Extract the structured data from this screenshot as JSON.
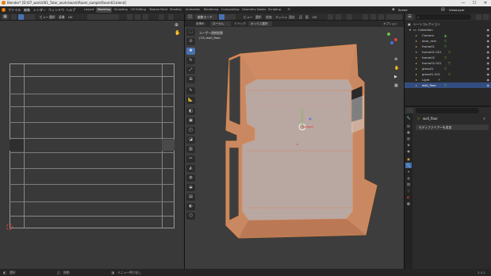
{
  "window": {
    "title": "Blender* [D:\\07_work\\001_Tutor_works\\work\\Room_sample\\Room03.blend]",
    "minimize": "—",
    "maximize": "☐",
    "close": "✕"
  },
  "menu": {
    "items": [
      "ファイル",
      "編集",
      "レンダー",
      "ウィンドウ",
      "ヘルプ"
    ],
    "workspaces": [
      "Layout",
      "Modeling",
      "Sculpting",
      "UV Editing",
      "Texture Paint",
      "Shading",
      "Animation",
      "Rendering",
      "Compositing",
      "Geometry Nodes",
      "Scripting"
    ],
    "active_workspace": "Modeling",
    "scene": "Scene",
    "view_layer": "ViewLayer"
  },
  "uv_editor": {
    "header_items": [
      "ビュー",
      "選択",
      "画像",
      "UV"
    ]
  },
  "viewport": {
    "mode": "編集モード",
    "header_items": [
      "ビュー",
      "選択",
      "追加",
      "メッシュ",
      "頂点",
      "辺",
      "面",
      "UV"
    ],
    "orientation_label": "座標系:",
    "orientation": "ローカル",
    "drag_label": "ドラッグ:",
    "drag": "ボックス選択",
    "options": "オプション",
    "overlay_line1": "ユーザー透視投影",
    "overlay_line2": "(15) wall_floor",
    "tools": [
      "cursor",
      "move",
      "rotate",
      "scale",
      "transform",
      "annotate",
      "measure",
      "add-cube",
      "extrude",
      "inset",
      "bevel",
      "loopcut",
      "knife",
      "polybuild",
      "spin",
      "smooth",
      "edge-slide",
      "shrink",
      "shear",
      "rip"
    ]
  },
  "outliner": {
    "title": "シーンコレクション",
    "collection": "Collection",
    "items": [
      {
        "name": "Camera",
        "color": "#e0a040"
      },
      {
        "name": "door_rear",
        "color": "#e0a040"
      },
      {
        "name": "frame01",
        "color": "#e0a040"
      },
      {
        "name": "frame01.001",
        "color": "#e0a040"
      },
      {
        "name": "frame02",
        "color": "#e0a040"
      },
      {
        "name": "frame02.001",
        "color": "#e0a040"
      },
      {
        "name": "glass01",
        "color": "#e0a040"
      },
      {
        "name": "glass01.001",
        "color": "#e0a040"
      },
      {
        "name": "Light",
        "color": "#e0a040"
      },
      {
        "name": "wall_floor",
        "color": "#e0a040"
      }
    ],
    "selected": "wall_floor"
  },
  "properties": {
    "object": "wall_floor",
    "add_modifier": "モディファイアーを追加"
  },
  "statusbar": {
    "left": "選択",
    "middle": "移動",
    "right": "メニュー呼び出し",
    "version": "3.4.1"
  },
  "colors": {
    "accent": "#4772b3",
    "select_orange": "#e08a4a"
  }
}
